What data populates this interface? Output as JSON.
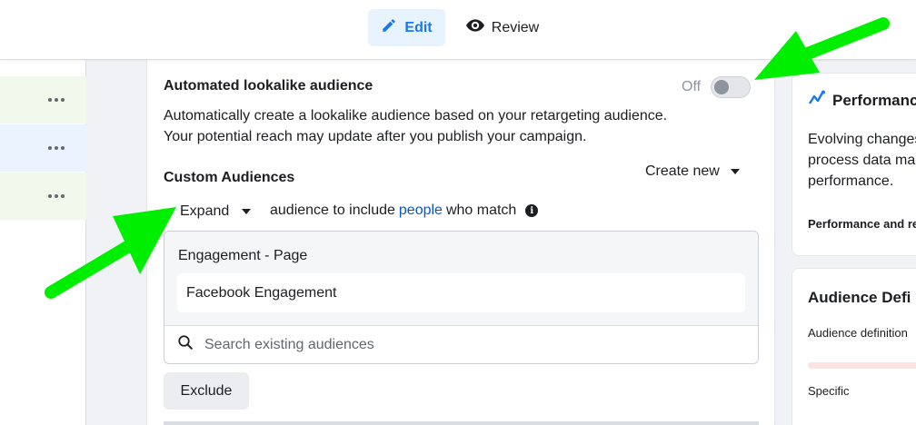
{
  "tabs": {
    "edit_label": "Edit",
    "review_label": "Review"
  },
  "lookalike": {
    "title": "Automated lookalike audience",
    "toggle_state": "Off",
    "description_line1": "Automatically create a lookalike audience based on your retargeting audience.",
    "description_line2": "Your potential reach may update after you publish your campaign."
  },
  "custom_audiences": {
    "title": "Custom Audiences",
    "create_new_label": "Create new",
    "expand_label": "Expand",
    "include_text_before": "audience to include",
    "include_link": "people",
    "include_text_after": "who match",
    "group_title": "Engagement - Page",
    "selected_audience": "Facebook Engagement",
    "search_placeholder": "Search existing audiences",
    "exclude_label": "Exclude"
  },
  "right_panel": {
    "performance_title": "Performance",
    "performance_text_line1": "Evolving changes",
    "performance_text_line2": "process data ma",
    "performance_text_line3": "performance.",
    "performance_subheading": "Performance and re",
    "audience_title": "Audience Defi",
    "audience_definition_label": "Audience definition",
    "audience_scale_label": "Specific"
  },
  "colors": {
    "accent": "#1877f2",
    "annotation_arrow": "#00ee00",
    "link": "#0a56c2"
  },
  "icons": {
    "edit": "pencil-icon",
    "review": "eye-icon",
    "more": "more-dots-icon",
    "info": "info-icon",
    "search": "search-icon",
    "performance": "trend-icon"
  }
}
